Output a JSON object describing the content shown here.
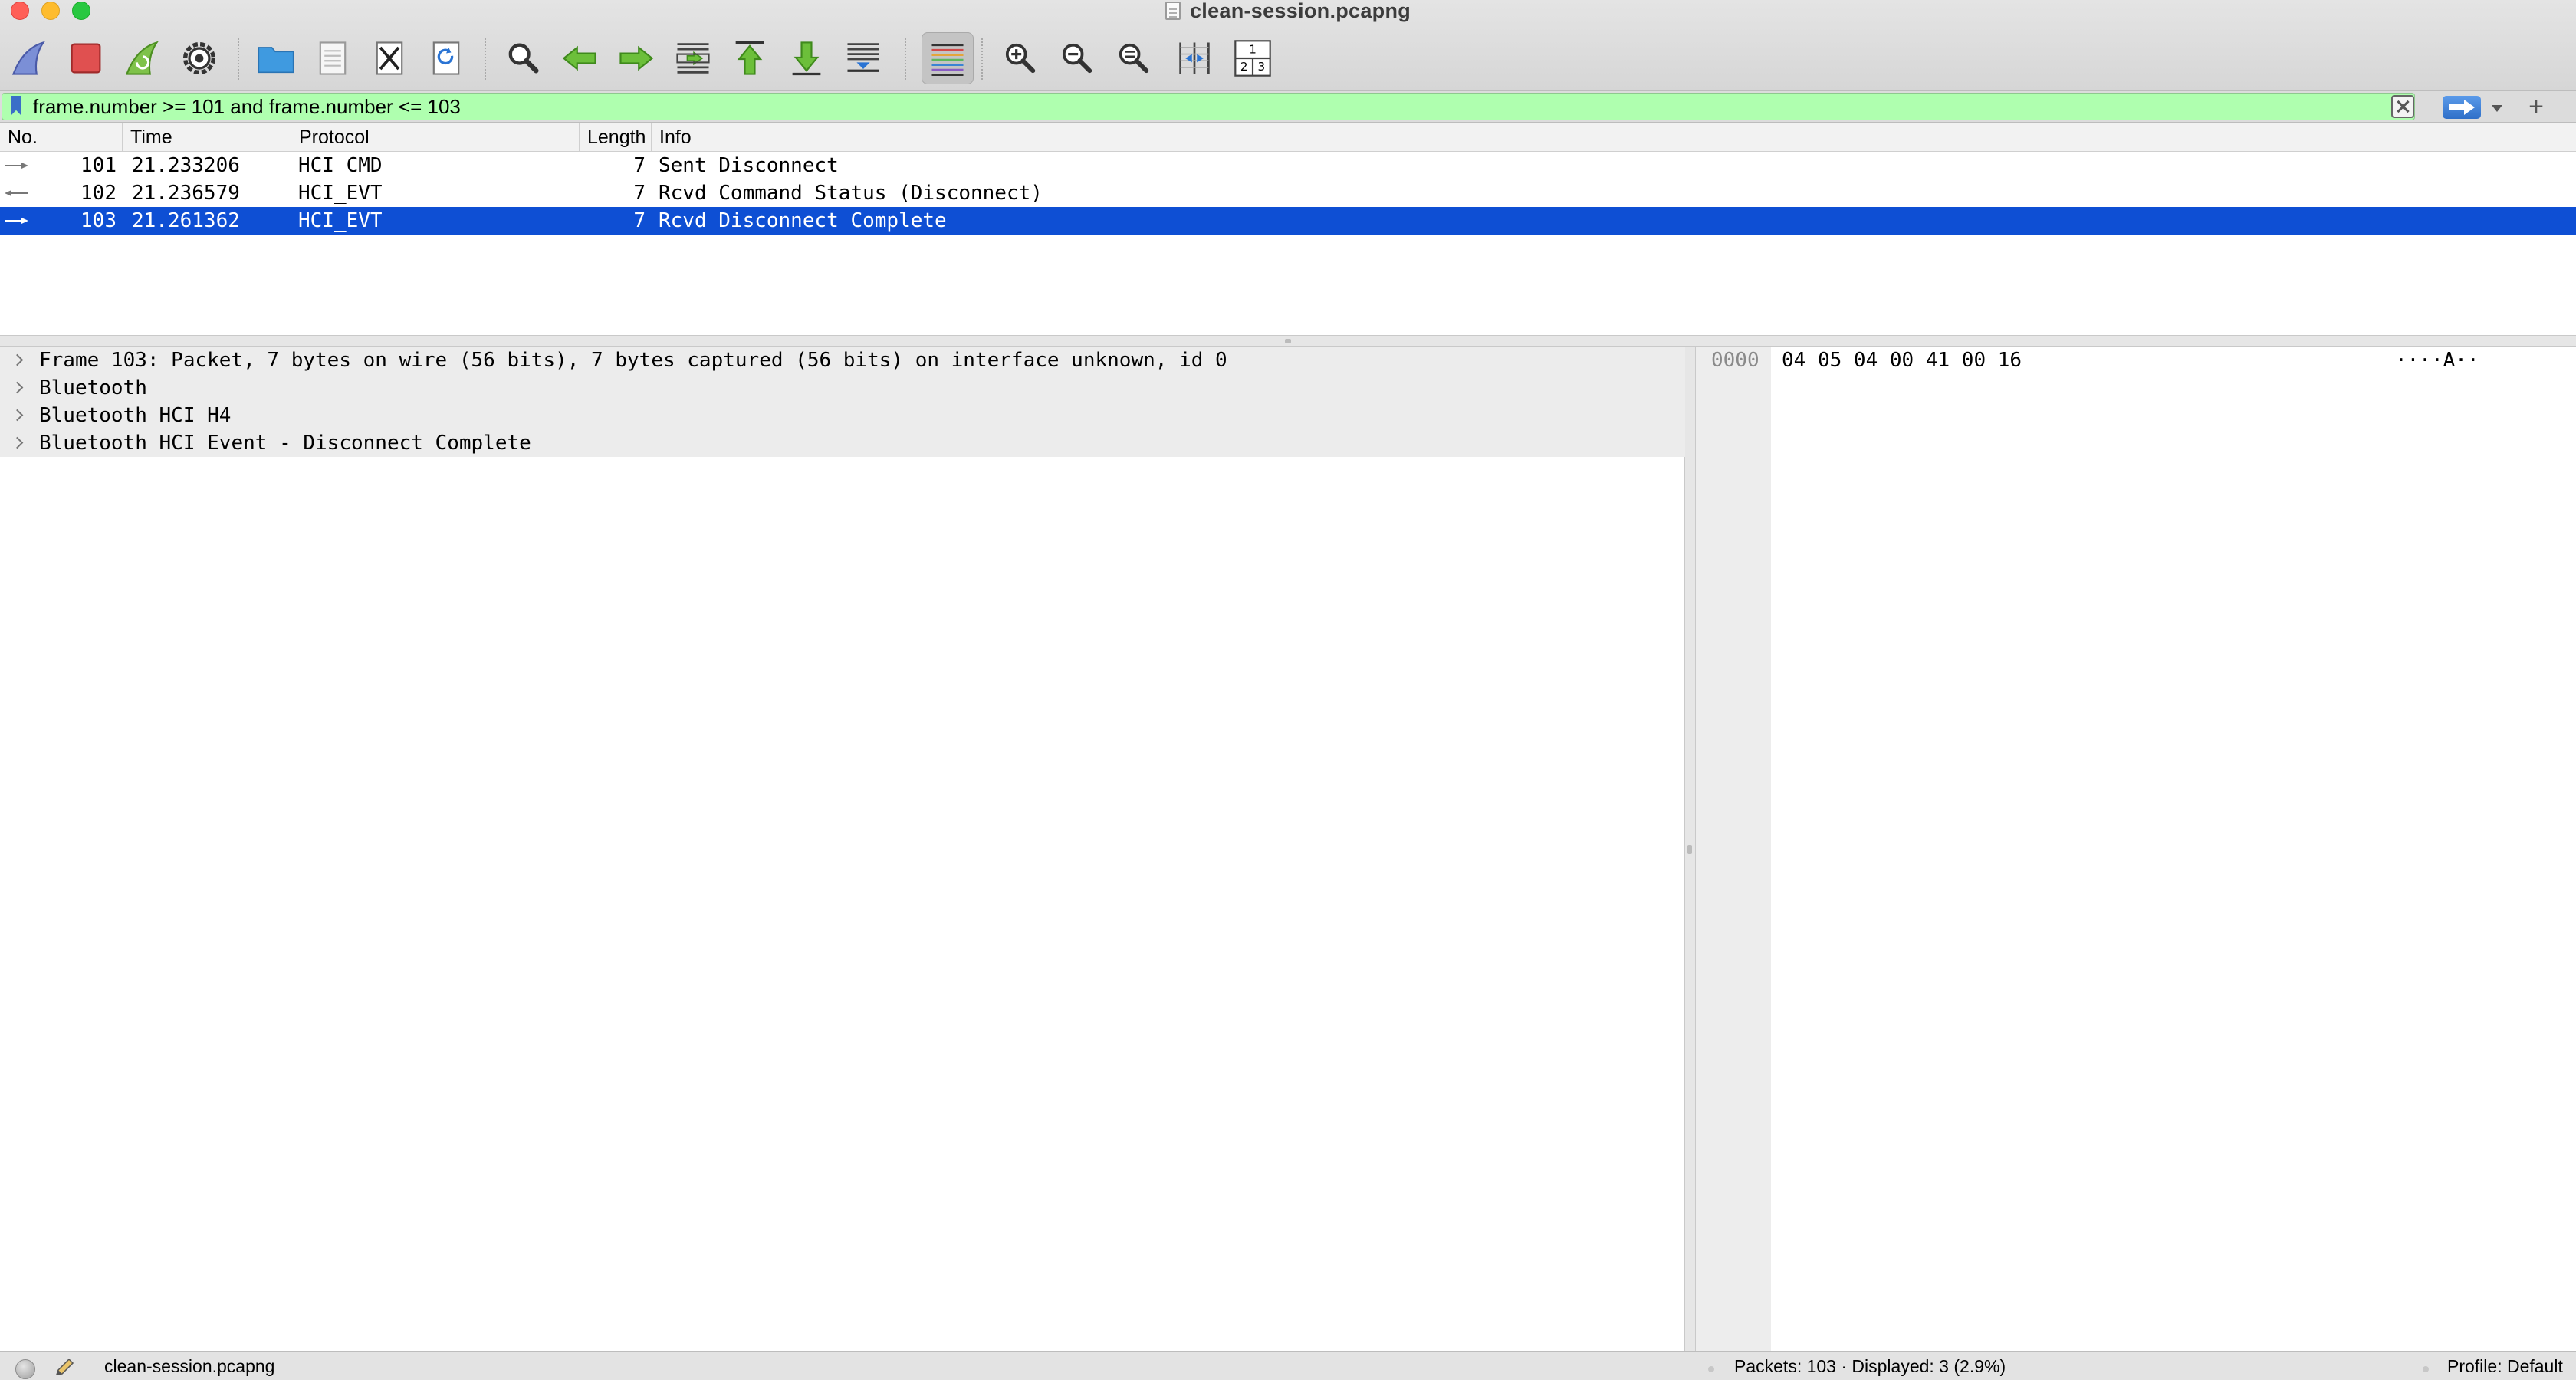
{
  "window": {
    "title": "clean-session.pcapng"
  },
  "toolbar": {
    "buttons": [
      {
        "name": "start-capture-button",
        "icon": "shark-fin-icon"
      },
      {
        "name": "stop-capture-button",
        "icon": "stop-icon"
      },
      {
        "name": "restart-capture-button",
        "icon": "restart-fin-icon"
      },
      {
        "name": "capture-options-button",
        "icon": "gear-icon"
      },
      {
        "name": "open-file-button",
        "icon": "folder-icon"
      },
      {
        "name": "save-file-button",
        "icon": "document-icon"
      },
      {
        "name": "close-file-button",
        "icon": "close-file-icon"
      },
      {
        "name": "reload-file-button",
        "icon": "reload-icon"
      },
      {
        "name": "find-packet-button",
        "icon": "magnifier-icon"
      },
      {
        "name": "go-back-button",
        "icon": "arrow-left-icon"
      },
      {
        "name": "go-forward-button",
        "icon": "arrow-right-icon"
      },
      {
        "name": "go-to-packet-button",
        "icon": "go-to-packet-icon"
      },
      {
        "name": "first-packet-button",
        "icon": "arrow-up-icon"
      },
      {
        "name": "last-packet-button",
        "icon": "arrow-down-icon"
      },
      {
        "name": "autoscroll-button",
        "icon": "autoscroll-icon"
      },
      {
        "name": "colorize-button",
        "icon": "colorize-icon"
      },
      {
        "name": "zoom-in-button",
        "icon": "zoom-in-icon"
      },
      {
        "name": "zoom-out-button",
        "icon": "zoom-out-icon"
      },
      {
        "name": "normal-size-button",
        "icon": "zoom-reset-icon"
      },
      {
        "name": "resize-columns-button",
        "icon": "resize-columns-icon"
      },
      {
        "name": "layout-button",
        "icon": "layout-icon"
      }
    ],
    "layout_icon_digits": [
      "1",
      "2",
      "3"
    ]
  },
  "filter": {
    "value": "frame.number >= 101 and frame.number <= 103",
    "background": "#afffaf",
    "add_label": "+"
  },
  "packet_list": {
    "columns": [
      "No.",
      "Time",
      "Protocol",
      "Length",
      "Info"
    ],
    "rows": [
      {
        "direction": "out",
        "no": "101",
        "time": "21.233206",
        "protocol": "HCI_CMD",
        "length": "7",
        "info": "Sent Disconnect",
        "selected": false
      },
      {
        "direction": "in",
        "no": "102",
        "time": "21.236579",
        "protocol": "HCI_EVT",
        "length": "7",
        "info": "Rcvd Command Status (Disconnect)",
        "selected": false
      },
      {
        "direction": "out",
        "no": "103",
        "time": "21.261362",
        "protocol": "HCI_EVT",
        "length": "7",
        "info": "Rcvd Disconnect Complete",
        "selected": true
      }
    ],
    "selection_color": "#0e4fd4"
  },
  "details": {
    "items": [
      {
        "label": "Frame 103: Packet, 7 bytes on wire (56 bits), 7 bytes captured (56 bits) on interface unknown, id 0"
      },
      {
        "label": "Bluetooth"
      },
      {
        "label": "Bluetooth HCI H4"
      },
      {
        "label": "Bluetooth HCI Event - Disconnect Complete"
      }
    ]
  },
  "bytes": {
    "offset": "0000",
    "hex": "04 05 04 00 41 00 16",
    "ascii": "····A··"
  },
  "status": {
    "file": "clean-session.pcapng",
    "packets": "Packets: 103 · Displayed: 3 (2.9%)",
    "profile": "Profile: Default"
  }
}
